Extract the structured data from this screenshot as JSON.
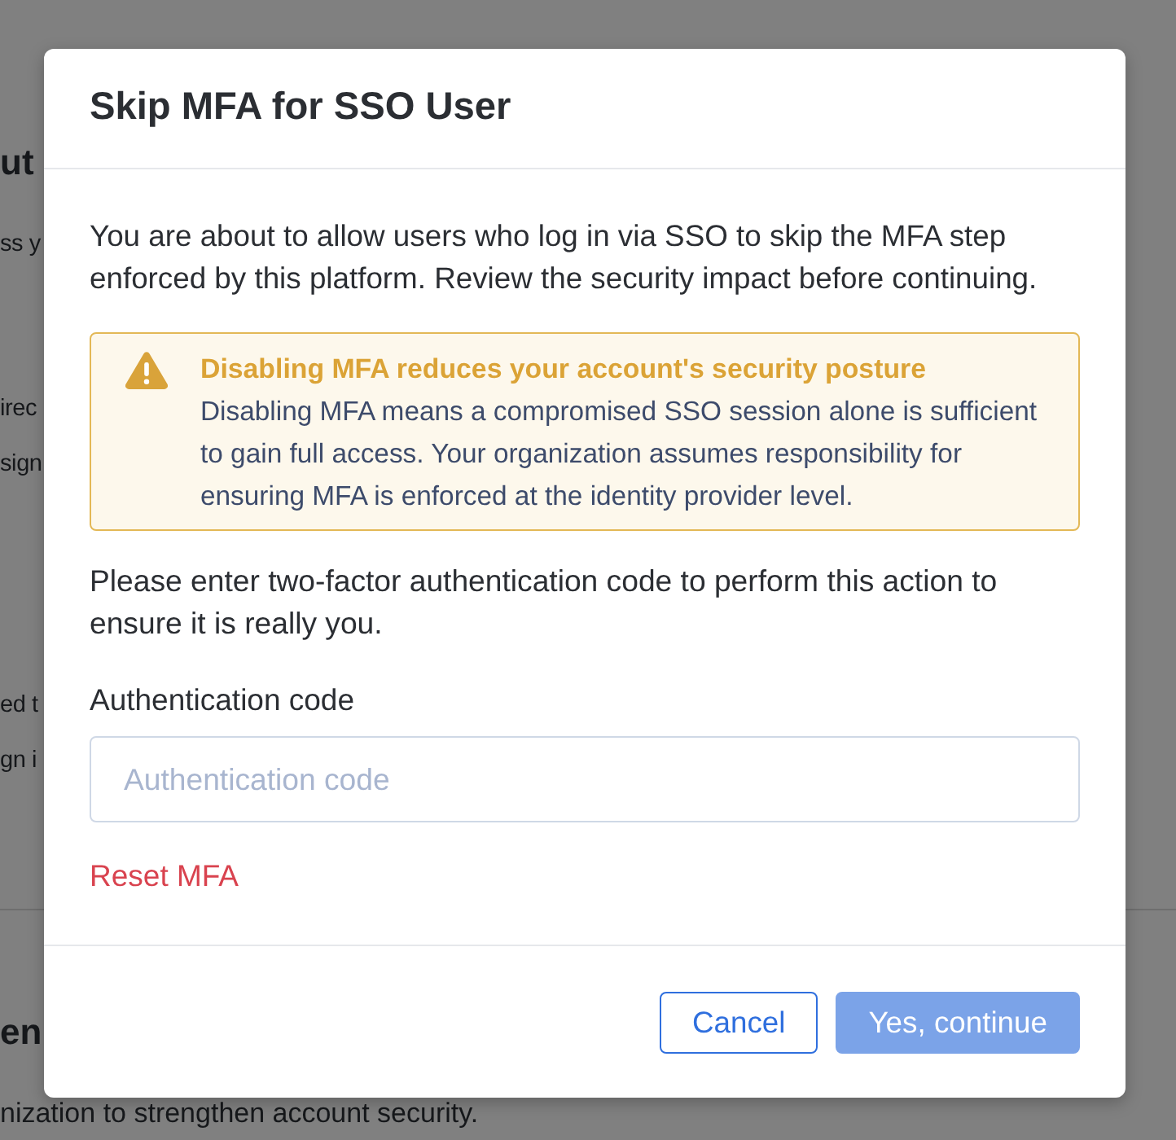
{
  "background_page": {
    "sections": [
      {
        "heading": "ut",
        "paragraphs": [
          [
            "ss y"
          ],
          [
            "irec",
            "sign"
          ],
          [
            "ed t",
            "gn i"
          ]
        ]
      },
      {
        "heading": "en",
        "paragraphs": [
          [
            "nization to strengthen account security."
          ]
        ]
      }
    ]
  },
  "modal": {
    "title": "Skip MFA for SSO User",
    "intro": "You are about to allow users who log in via SSO to skip the MFA step enforced by this platform. Review the security impact before continuing.",
    "alert": {
      "kind": "warning",
      "title": "Disabling MFA reduces your account's security posture",
      "text": "Disabling MFA means a compromised SSO session alone is sufficient to gain full access. Your organization assumes responsibility for ensuring MFA is enforced at the identity provider level."
    },
    "instruction": "Please enter two-factor authentication code to perform this action to ensure it is really you.",
    "field": {
      "label": "Authentication code",
      "placeholder": "Authentication code"
    },
    "link": "Reset MFA",
    "buttons": [
      {
        "label": "Cancel",
        "kind": "outline",
        "disabled": false
      },
      {
        "label": "Yes, continue",
        "kind": "primary",
        "disabled": true
      }
    ]
  }
}
